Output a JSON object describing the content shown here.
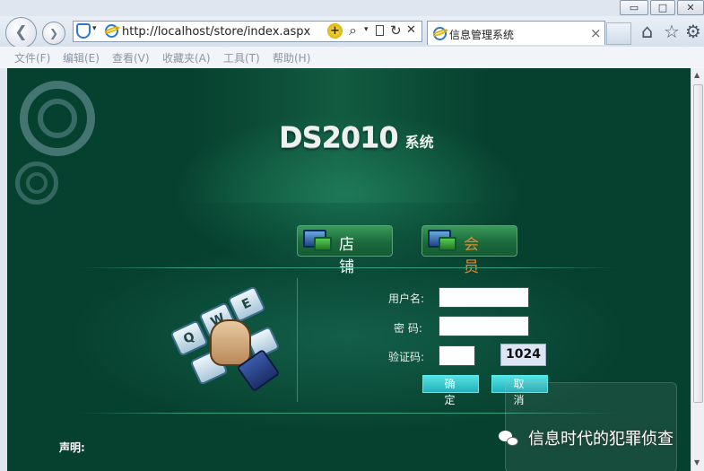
{
  "window": {
    "controls": {
      "minimize": "▭",
      "maximize": "□",
      "close": "✕"
    }
  },
  "toolbar": {
    "back": "❮",
    "forward": "❯",
    "address_url": "http://localhost/store/index.aspx",
    "search_glyph": "⌕",
    "refresh_glyph": "↻",
    "stop_glyph": "✕",
    "tab_title": "信息管理系统",
    "tab_close": "×",
    "home_glyph": "⌂",
    "favorites_glyph": "☆",
    "settings_glyph": "⚙"
  },
  "menu": {
    "items": [
      "文件(F)",
      "编辑(E)",
      "查看(V)",
      "收藏夹(A)",
      "工具(T)",
      "帮助(H)"
    ]
  },
  "page": {
    "logo_main": "DS2010",
    "logo_sub": "系统",
    "module_store": "店 铺",
    "module_member": "会 员",
    "labels": {
      "username": "用户名:",
      "password": "密 码:",
      "captcha": "验证码:"
    },
    "inputs": {
      "username": "",
      "password": "",
      "captcha": ""
    },
    "captcha_code": "1024",
    "buttons": {
      "confirm": "确 定",
      "cancel": "取 消"
    },
    "declaration_title": "声明:",
    "keyboard_keys": [
      "Q",
      "W",
      "E"
    ]
  },
  "watermark": {
    "text": "信息时代的犯罪侦查"
  },
  "colors": {
    "page_bg": "#06402e",
    "module_text_store": "#ffffff",
    "module_text_member": "#e58a2a",
    "button_cyan": "#22b1bb"
  }
}
